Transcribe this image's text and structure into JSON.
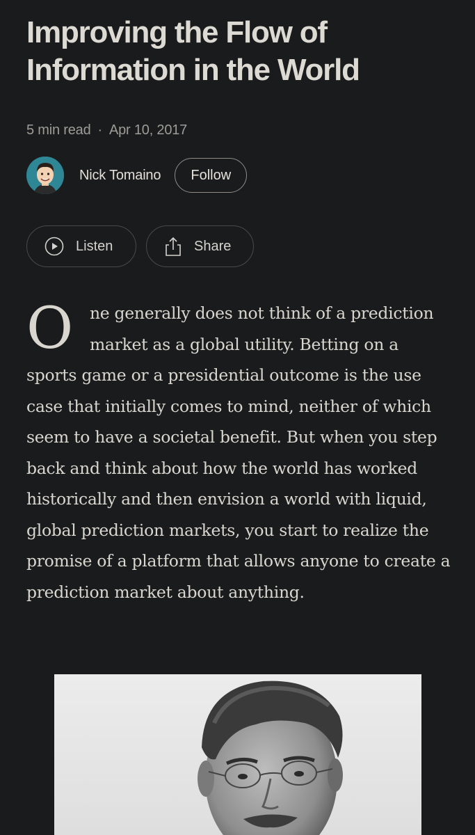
{
  "article": {
    "title": "Improving the Flow of Information in the World",
    "read_time": "5 min read",
    "separator": "·",
    "date": "Apr 10, 2017",
    "drop_cap": "O",
    "body": "ne generally does not think of a prediction market as a global utility. Betting on a sports game or a presidential outcome is the use case that initially comes to mind, neither of which seem to have a societal benefit. But when you step back and think about how the world has worked historically and then envision a world with liquid, global prediction markets, you start to realize the promise of a platform that allows anyone to create a prediction market about anything."
  },
  "author": {
    "name": "Nick Tomaino",
    "follow_label": "Follow"
  },
  "actions": {
    "listen_label": "Listen",
    "share_label": "Share",
    "listen_icon": "play-circle-icon",
    "share_icon": "share-upload-icon"
  },
  "colors": {
    "background": "#1a1b1c",
    "text": "#e6e3dc",
    "muted": "#9e9c97",
    "pill_border": "#4a4a4a"
  }
}
